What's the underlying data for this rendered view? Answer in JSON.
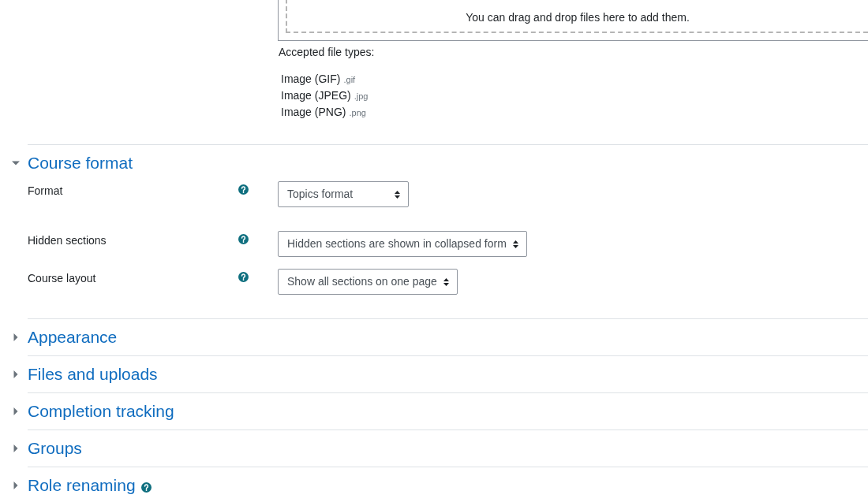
{
  "file_picker": {
    "drop_hint": "You can drag and drop files here to add them.",
    "accepted_label": "Accepted file types:",
    "file_types": [
      {
        "name": "Image (GIF)",
        "extension": ".gif"
      },
      {
        "name": "Image (JPEG)",
        "extension": ".jpg"
      },
      {
        "name": "Image (PNG)",
        "extension": ".png"
      }
    ]
  },
  "sections": [
    {
      "title": "Course format",
      "expanded": true,
      "fields": [
        {
          "label": "Format",
          "value": "Topics format"
        },
        {
          "label": "Hidden sections",
          "value": "Hidden sections are shown in collapsed form"
        },
        {
          "label": "Course layout",
          "value": "Show all sections on one page"
        }
      ]
    },
    {
      "title": "Appearance",
      "expanded": false
    },
    {
      "title": "Files and uploads",
      "expanded": false
    },
    {
      "title": "Completion tracking",
      "expanded": false
    },
    {
      "title": "Groups",
      "expanded": false
    },
    {
      "title": "Role renaming",
      "expanded": false,
      "help": true
    }
  ]
}
